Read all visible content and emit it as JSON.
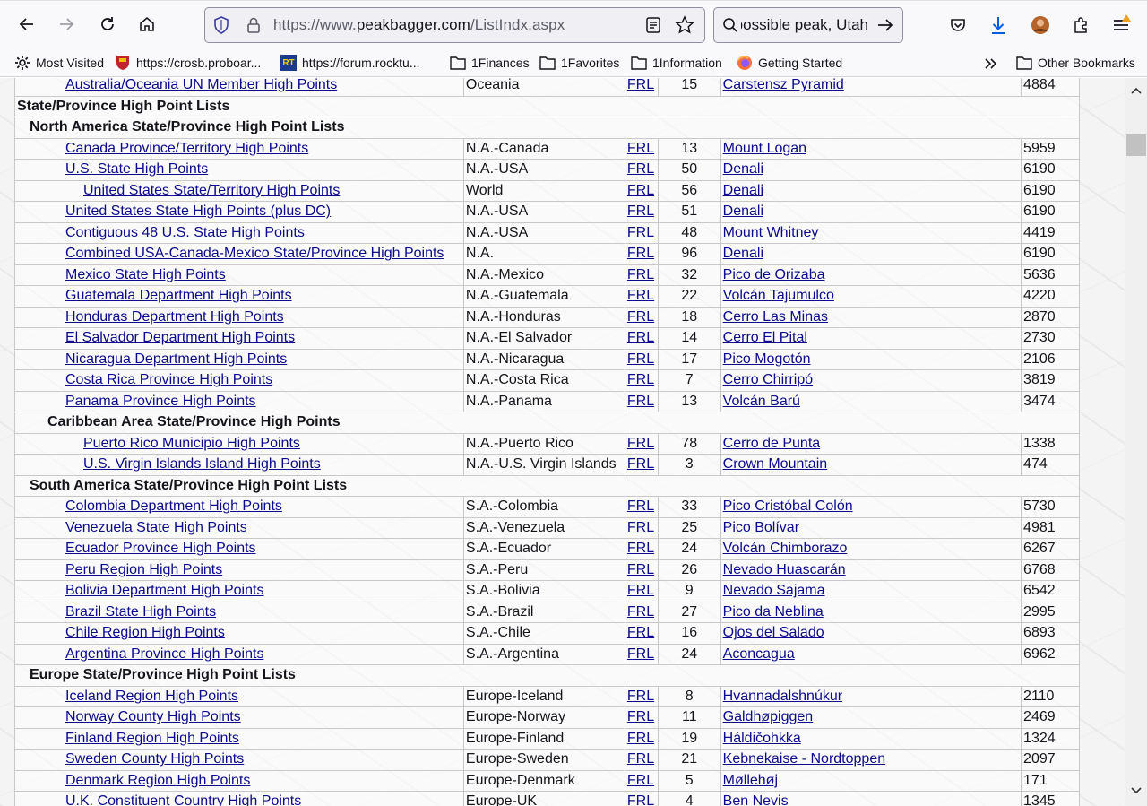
{
  "browser": {
    "url_prefix": "https://www.",
    "url_host": "peakbagger.com",
    "url_path": "/ListIndx.aspx",
    "search_text": "possible peak, Utah",
    "accent_color": "#0060df"
  },
  "bookmarks": [
    {
      "label": "Most Visited",
      "icon": "gear-icon"
    },
    {
      "label": "https://crosb.proboar...",
      "icon": "shield-favicon"
    },
    {
      "label": "https://forum.rocktu...",
      "icon": "rt-favicon"
    },
    {
      "label": "1Finances",
      "icon": "folder-icon"
    },
    {
      "label": "1Favorites",
      "icon": "folder-icon"
    },
    {
      "label": "1Information",
      "icon": "folder-icon"
    },
    {
      "label": "Getting Started",
      "icon": "firefox-icon"
    },
    {
      "label": "Other Bookmarks",
      "icon": "folder-icon"
    }
  ],
  "table": {
    "frl_label": "FRL",
    "top_row": {
      "name": "Australia/Oceania UN Member High Points",
      "region": "Oceania",
      "count": "15",
      "peak": "Carstensz Pyramid",
      "elev": "4884"
    },
    "heading_main": "State/Province High Point Lists",
    "north_america": {
      "heading": "North America State/Province High Point Lists",
      "rows": [
        {
          "name": "Canada Province/Territory High Points",
          "region": "N.A.-Canada",
          "count": "13",
          "peak": "Mount Logan",
          "elev": "5959"
        },
        {
          "name": "U.S. State High Points",
          "region": "N.A.-USA",
          "count": "50",
          "peak": "Denali",
          "elev": "6190"
        },
        {
          "name": "United States State/Territory High Points",
          "region": "World",
          "count": "56",
          "peak": "Denali",
          "elev": "6190",
          "indent": 2
        },
        {
          "name": "United States State High Points (plus DC)",
          "region": "N.A.-USA",
          "count": "51",
          "peak": "Denali",
          "elev": "6190"
        },
        {
          "name": "Contiguous 48 U.S. State High Points",
          "region": "N.A.-USA",
          "count": "48",
          "peak": "Mount Whitney",
          "elev": "4419"
        },
        {
          "name": "Combined USA-Canada-Mexico State/Province High Points",
          "region": "N.A.",
          "count": "96",
          "peak": "Denali",
          "elev": "6190"
        },
        {
          "name": "Mexico State High Points",
          "region": "N.A.-Mexico",
          "count": "32",
          "peak": "Pico de Orizaba",
          "elev": "5636"
        },
        {
          "name": "Guatemala Department High Points",
          "region": "N.A.-Guatemala",
          "count": "22",
          "peak": "Volcán Tajumulco",
          "elev": "4220"
        },
        {
          "name": "Honduras Department High Points",
          "region": "N.A.-Honduras",
          "count": "18",
          "peak": "Cerro Las Minas",
          "elev": "2870"
        },
        {
          "name": "El Salvador Department High Points",
          "region": "N.A.-El Salvador",
          "count": "14",
          "peak": "Cerro El Pital",
          "elev": "2730"
        },
        {
          "name": "Nicaragua Department High Points",
          "region": "N.A.-Nicaragua",
          "count": "17",
          "peak": "Pico Mogotón",
          "elev": "2106"
        },
        {
          "name": "Costa Rica Province High Points",
          "region": "N.A.-Costa Rica",
          "count": "7",
          "peak": "Cerro Chirripó",
          "elev": "3819"
        },
        {
          "name": "Panama Province High Points",
          "region": "N.A.-Panama",
          "count": "13",
          "peak": "Volcán Barú",
          "elev": "3474"
        }
      ]
    },
    "caribbean": {
      "heading": "Caribbean Area State/Province High Points",
      "rows": [
        {
          "name": "Puerto Rico Municipio High Points",
          "region": "N.A.-Puerto Rico",
          "count": "78",
          "peak": "Cerro de Punta",
          "elev": "1338",
          "indent": 2
        },
        {
          "name": "U.S. Virgin Islands Island High Points",
          "region": "N.A.-U.S. Virgin Islands",
          "count": "3",
          "peak": "Crown Mountain",
          "elev": "474",
          "indent": 2
        }
      ]
    },
    "south_america": {
      "heading": "South America State/Province High Point Lists",
      "rows": [
        {
          "name": "Colombia Department High Points",
          "region": "S.A.-Colombia",
          "count": "33",
          "peak": "Pico Cristóbal Colón",
          "elev": "5730"
        },
        {
          "name": "Venezuela State High Points",
          "region": "S.A.-Venezuela",
          "count": "25",
          "peak": "Pico Bolívar",
          "elev": "4981"
        },
        {
          "name": "Ecuador Province High Points",
          "region": "S.A.-Ecuador",
          "count": "24",
          "peak": "Volcán Chimborazo",
          "elev": "6267"
        },
        {
          "name": "Peru Region High Points",
          "region": "S.A.-Peru",
          "count": "26",
          "peak": "Nevado Huascarán",
          "elev": "6768"
        },
        {
          "name": "Bolivia Department High Points",
          "region": "S.A.-Bolivia",
          "count": "9",
          "peak": "Nevado Sajama",
          "elev": "6542"
        },
        {
          "name": "Brazil State High Points",
          "region": "S.A.-Brazil",
          "count": "27",
          "peak": "Pico da Neblina",
          "elev": "2995"
        },
        {
          "name": "Chile Region High Points",
          "region": "S.A.-Chile",
          "count": "16",
          "peak": "Ojos del Salado",
          "elev": "6893"
        },
        {
          "name": "Argentina Province High Points",
          "region": "S.A.-Argentina",
          "count": "24",
          "peak": "Aconcagua",
          "elev": "6962"
        }
      ]
    },
    "europe": {
      "heading": "Europe State/Province High Point Lists",
      "rows": [
        {
          "name": "Iceland Region High Points",
          "region": "Europe-Iceland",
          "count": "8",
          "peak": "Hvannadalshnúkur",
          "elev": "2110"
        },
        {
          "name": "Norway County High Points",
          "region": "Europe-Norway",
          "count": "11",
          "peak": "Galdhøpiggen",
          "elev": "2469"
        },
        {
          "name": "Finland Region High Points",
          "region": "Europe-Finland",
          "count": "19",
          "peak": "Háldičohkka",
          "elev": "1324"
        },
        {
          "name": "Sweden County High Points",
          "region": "Europe-Sweden",
          "count": "21",
          "peak": "Kebnekaise - Nordtoppen",
          "elev": "2097"
        },
        {
          "name": "Denmark Region High Points",
          "region": "Europe-Denmark",
          "count": "5",
          "peak": "Møllehøj",
          "elev": "171"
        },
        {
          "name": "U.K. Constituent Country High Points",
          "region": "Europe-UK",
          "count": "4",
          "peak": "Ben Nevis",
          "elev": "1345"
        }
      ]
    }
  }
}
